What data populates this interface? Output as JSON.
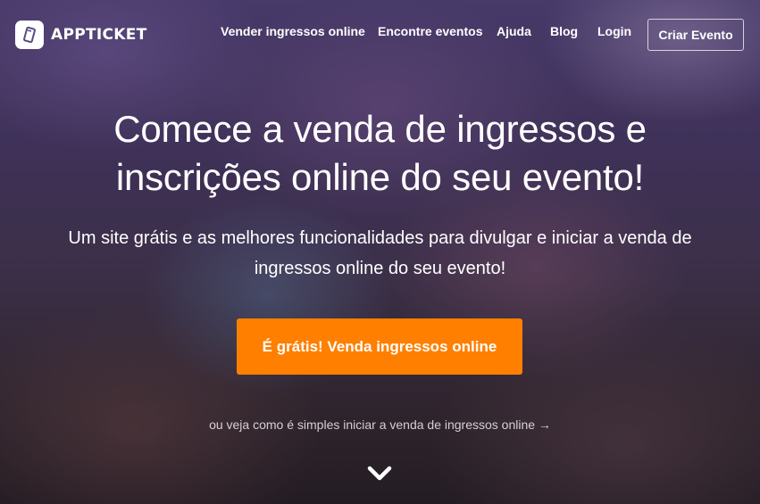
{
  "brand": {
    "name": "APPTICKET",
    "logo_icon": "ticket-icon"
  },
  "nav": {
    "items": [
      {
        "label": "Vender ingressos online"
      },
      {
        "label": "Encontre eventos"
      },
      {
        "label": "Ajuda"
      },
      {
        "label": "Blog"
      },
      {
        "label": "Login"
      }
    ],
    "create_event_label": "Criar Evento"
  },
  "hero": {
    "headline_line1": "Comece a venda de ingressos e",
    "headline_line2": "inscrições online do seu evento!",
    "subline_line1": "Um site grátis e as melhores funcionalidades para divulgar e iniciar a venda de",
    "subline_line2": "ingressos online do seu evento!",
    "primary_cta_label": "É grátis! Venda ingressos online",
    "secondary_link_label": "ou veja como é simples iniciar a venda de ingressos online →",
    "scroll_icon": "chevron-down-icon"
  },
  "colors": {
    "accent": "#ff7f00",
    "text": "#ffffff"
  }
}
